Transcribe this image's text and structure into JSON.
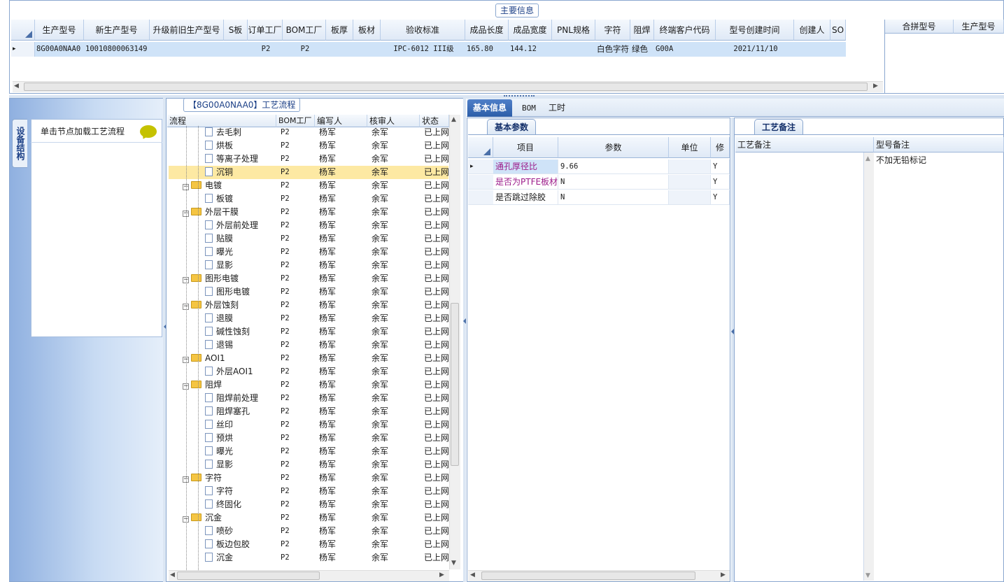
{
  "main_info": {
    "legend": "主要信息",
    "columns": [
      "生产型号",
      "新生产型号",
      "升级前旧生产型号",
      "S板",
      "订单工厂",
      "BOM工厂",
      "板厚",
      "板材",
      "验收标准",
      "成品长度",
      "成品宽度",
      "PNL规格",
      "字符",
      "阻焊",
      "终端客户代码",
      "型号创建时间",
      "创建人",
      "SO"
    ],
    "row": {
      "model": "8G00A0NAA0",
      "new_model": "10010800063149",
      "old_model": "",
      "s_board": "",
      "order_factory": "P2",
      "bom_factory": "P2",
      "thickness": "",
      "material": "",
      "standard": "IPC-6012 III级",
      "length": "165.80",
      "width": "144.12",
      "pnl": "",
      "char": "白色字符",
      "mask": "绿色",
      "customer": "G00A",
      "created": "2021/11/10",
      "creator": "",
      "so": ""
    },
    "side_columns": [
      "合拼型号",
      "生产型号"
    ],
    "row_marker": "▸"
  },
  "device_panel": {
    "vertical_tab": "设备结构",
    "hint": "单击节点加载工艺流程"
  },
  "flow_panel": {
    "legend": "【8G00A0NAA0】工艺流程",
    "columns": [
      "流程",
      "BOM工厂",
      "编写人",
      "核审人",
      "状态"
    ],
    "rows": [
      {
        "level": 2,
        "type": "doc",
        "name": "去毛刺",
        "bom": "P2",
        "writer": "杨军",
        "reviewer": "余军",
        "status": "已上网"
      },
      {
        "level": 2,
        "type": "doc",
        "name": "烘板",
        "bom": "P2",
        "writer": "杨军",
        "reviewer": "余军",
        "status": "已上网"
      },
      {
        "level": 2,
        "type": "doc",
        "name": "等离子处理",
        "bom": "P2",
        "writer": "杨军",
        "reviewer": "余军",
        "status": "已上网"
      },
      {
        "level": 2,
        "type": "doc",
        "name": "沉铜",
        "bom": "P2",
        "writer": "杨军",
        "reviewer": "余军",
        "status": "已上网",
        "selected": true
      },
      {
        "level": 1,
        "type": "folder",
        "name": "电镀",
        "bom": "P2",
        "writer": "杨军",
        "reviewer": "余军",
        "status": "已上网"
      },
      {
        "level": 2,
        "type": "doc",
        "name": "板镀",
        "bom": "P2",
        "writer": "杨军",
        "reviewer": "余军",
        "status": "已上网"
      },
      {
        "level": 1,
        "type": "folder",
        "name": "外层干膜",
        "bom": "P2",
        "writer": "杨军",
        "reviewer": "余军",
        "status": "已上网"
      },
      {
        "level": 2,
        "type": "doc",
        "name": "外层前处理",
        "bom": "P2",
        "writer": "杨军",
        "reviewer": "余军",
        "status": "已上网"
      },
      {
        "level": 2,
        "type": "doc",
        "name": "贴膜",
        "bom": "P2",
        "writer": "杨军",
        "reviewer": "余军",
        "status": "已上网"
      },
      {
        "level": 2,
        "type": "doc",
        "name": "曝光",
        "bom": "P2",
        "writer": "杨军",
        "reviewer": "余军",
        "status": "已上网"
      },
      {
        "level": 2,
        "type": "doc",
        "name": "显影",
        "bom": "P2",
        "writer": "杨军",
        "reviewer": "余军",
        "status": "已上网"
      },
      {
        "level": 1,
        "type": "folder",
        "name": "图形电镀",
        "bom": "P2",
        "writer": "杨军",
        "reviewer": "余军",
        "status": "已上网"
      },
      {
        "level": 2,
        "type": "doc",
        "name": "图形电镀",
        "bom": "P2",
        "writer": "杨军",
        "reviewer": "余军",
        "status": "已上网"
      },
      {
        "level": 1,
        "type": "folder",
        "name": "外层蚀刻",
        "bom": "P2",
        "writer": "杨军",
        "reviewer": "余军",
        "status": "已上网"
      },
      {
        "level": 2,
        "type": "doc",
        "name": "退膜",
        "bom": "P2",
        "writer": "杨军",
        "reviewer": "余军",
        "status": "已上网"
      },
      {
        "level": 2,
        "type": "doc",
        "name": "碱性蚀刻",
        "bom": "P2",
        "writer": "杨军",
        "reviewer": "余军",
        "status": "已上网"
      },
      {
        "level": 2,
        "type": "doc",
        "name": "退锡",
        "bom": "P2",
        "writer": "杨军",
        "reviewer": "余军",
        "status": "已上网"
      },
      {
        "level": 1,
        "type": "folder",
        "name": "AOI1",
        "bom": "P2",
        "writer": "杨军",
        "reviewer": "余军",
        "status": "已上网"
      },
      {
        "level": 2,
        "type": "doc",
        "name": "外层AOI1",
        "bom": "P2",
        "writer": "杨军",
        "reviewer": "余军",
        "status": "已上网"
      },
      {
        "level": 1,
        "type": "folder",
        "name": "阻焊",
        "bom": "P2",
        "writer": "杨军",
        "reviewer": "余军",
        "status": "已上网"
      },
      {
        "level": 2,
        "type": "doc",
        "name": "阻焊前处理",
        "bom": "P2",
        "writer": "杨军",
        "reviewer": "余军",
        "status": "已上网"
      },
      {
        "level": 2,
        "type": "doc",
        "name": "阻焊塞孔",
        "bom": "P2",
        "writer": "杨军",
        "reviewer": "余军",
        "status": "已上网"
      },
      {
        "level": 2,
        "type": "doc",
        "name": "丝印",
        "bom": "P2",
        "writer": "杨军",
        "reviewer": "余军",
        "status": "已上网"
      },
      {
        "level": 2,
        "type": "doc",
        "name": "预烘",
        "bom": "P2",
        "writer": "杨军",
        "reviewer": "余军",
        "status": "已上网"
      },
      {
        "level": 2,
        "type": "doc",
        "name": "曝光",
        "bom": "P2",
        "writer": "杨军",
        "reviewer": "余军",
        "status": "已上网"
      },
      {
        "level": 2,
        "type": "doc",
        "name": "显影",
        "bom": "P2",
        "writer": "杨军",
        "reviewer": "余军",
        "status": "已上网"
      },
      {
        "level": 1,
        "type": "folder",
        "name": "字符",
        "bom": "P2",
        "writer": "杨军",
        "reviewer": "余军",
        "status": "已上网"
      },
      {
        "level": 2,
        "type": "doc",
        "name": "字符",
        "bom": "P2",
        "writer": "杨军",
        "reviewer": "余军",
        "status": "已上网"
      },
      {
        "level": 2,
        "type": "doc",
        "name": "终固化",
        "bom": "P2",
        "writer": "杨军",
        "reviewer": "余军",
        "status": "已上网"
      },
      {
        "level": 1,
        "type": "folder",
        "name": "沉金",
        "bom": "P2",
        "writer": "杨军",
        "reviewer": "余军",
        "status": "已上网"
      },
      {
        "level": 2,
        "type": "doc",
        "name": "喷砂",
        "bom": "P2",
        "writer": "杨军",
        "reviewer": "余军",
        "status": "已上网"
      },
      {
        "level": 2,
        "type": "doc",
        "name": "板边包胶",
        "bom": "P2",
        "writer": "杨军",
        "reviewer": "余军",
        "status": "已上网"
      },
      {
        "level": 2,
        "type": "doc",
        "name": "沉金",
        "bom": "P2",
        "writer": "杨军",
        "reviewer": "余军",
        "status": "已上网"
      }
    ]
  },
  "right_tabs": [
    "基本信息",
    "BOM",
    "工时"
  ],
  "params_panel": {
    "subtab": "基本参数",
    "columns": [
      "项目",
      "参数",
      "单位",
      "修"
    ],
    "rows": [
      {
        "item": "通孔厚径比",
        "value": "9.66",
        "unit": "",
        "mod": "Y",
        "color": "#9c1b8a"
      },
      {
        "item": "是否为PTFE板材",
        "value": "N",
        "unit": "",
        "mod": "Y",
        "color": "#9c1b8a"
      },
      {
        "item": "是否跳过除胶",
        "value": "N",
        "unit": "",
        "mod": "Y",
        "color": "#1a1a1a"
      }
    ]
  },
  "notes_panel": {
    "subtab": "工艺备注",
    "columns": [
      "工艺备注",
      "型号备注"
    ],
    "model_note": "不加无铅标记"
  },
  "colors": {
    "border": "#8aa7cf",
    "accent": "#2c5ea8",
    "selected_row": "#fde9a3",
    "grid_row": "#cfe3f8"
  }
}
